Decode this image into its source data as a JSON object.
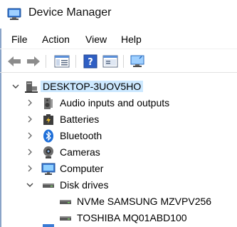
{
  "window": {
    "title": "Device Manager",
    "icon": "device-manager-icon"
  },
  "menu": [
    "File",
    "Action",
    "View",
    "Help"
  ],
  "toolbar": {
    "buttons": [
      "back-arrow-icon",
      "forward-arrow-icon",
      "properties-icon",
      "help-icon",
      "show-hide-pane-icon",
      "scan-hardware-icon"
    ]
  },
  "tree": {
    "root": {
      "label": "DESKTOP-3UOV5HO",
      "expanded": true,
      "icon": "computer-tower-icon"
    },
    "items": [
      {
        "label": "Audio inputs and outputs",
        "expanded": false,
        "icon": "speaker-icon"
      },
      {
        "label": "Batteries",
        "expanded": false,
        "icon": "battery-icon"
      },
      {
        "label": "Bluetooth",
        "expanded": false,
        "icon": "bluetooth-icon"
      },
      {
        "label": "Cameras",
        "expanded": false,
        "icon": "camera-icon"
      },
      {
        "label": "Computer",
        "expanded": false,
        "icon": "monitor-icon"
      },
      {
        "label": "Disk drives",
        "expanded": true,
        "icon": "disk-drive-icon",
        "children": [
          {
            "label": "NVMe SAMSUNG MZVPV256",
            "icon": "disk-drive-icon"
          },
          {
            "label": "TOSHIBA MQ01ABD100",
            "icon": "disk-drive-icon"
          }
        ]
      }
    ]
  },
  "colors": {
    "selection": "#cce8ff",
    "accent": "#1e6fd9"
  }
}
